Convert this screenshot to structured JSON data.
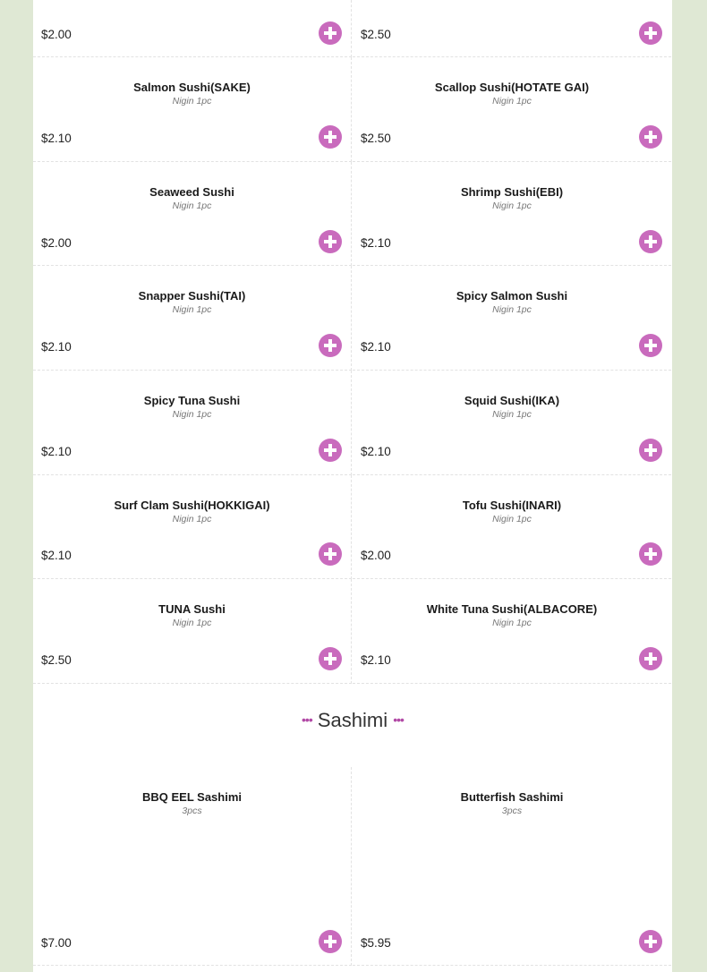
{
  "colors": {
    "accent": "#c96bbd",
    "dots": "#b24aa6",
    "background": "#dfe8d4"
  },
  "add_icon": "plus-circle-icon",
  "top_row": [
    {
      "price": "$2.00"
    },
    {
      "price": "$2.50"
    }
  ],
  "sushi": [
    {
      "name": "Salmon Sushi(SAKE)",
      "sub": "Nigin 1pc",
      "price": "$2.10"
    },
    {
      "name": "Scallop Sushi(HOTATE GAI)",
      "sub": "Nigin 1pc",
      "price": "$2.50"
    },
    {
      "name": "Seaweed Sushi",
      "sub": "Nigin 1pc",
      "price": "$2.00"
    },
    {
      "name": "Shrimp Sushi(EBI)",
      "sub": "Nigin 1pc",
      "price": "$2.10"
    },
    {
      "name": "Snapper Sushi(TAI)",
      "sub": "Nigin 1pc",
      "price": "$2.10"
    },
    {
      "name": "Spicy Salmon Sushi",
      "sub": "Nigin 1pc",
      "price": "$2.10"
    },
    {
      "name": "Spicy Tuna Sushi",
      "sub": "Nigin 1pc",
      "price": "$2.10"
    },
    {
      "name": "Squid Sushi(IKA)",
      "sub": "Nigin 1pc",
      "price": "$2.10"
    },
    {
      "name": "Surf Clam Sushi(HOKKIGAI)",
      "sub": "Nigin 1pc",
      "price": "$2.10"
    },
    {
      "name": "Tofu Sushi(INARI)",
      "sub": "Nigin 1pc",
      "price": "$2.00"
    },
    {
      "name": "TUNA Sushi",
      "sub": "Nigin 1pc",
      "price": "$2.50"
    },
    {
      "name": "White Tuna Sushi(ALBACORE)",
      "sub": "Nigin 1pc",
      "price": "$2.10"
    }
  ],
  "sashimi_section": {
    "title": "Sashimi",
    "dots": "•••",
    "items": [
      {
        "name": "BBQ EEL Sashimi",
        "sub": "3pcs",
        "price": "$7.00"
      },
      {
        "name": "Butterfish Sashimi",
        "sub": "3pcs",
        "price": "$5.95"
      }
    ]
  }
}
